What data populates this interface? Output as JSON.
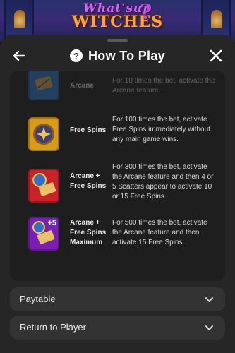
{
  "game": {
    "logo_line1": "What'sup",
    "logo_line2": "WITCHES",
    "logo_mark": "?"
  },
  "header": {
    "title": "How To Play",
    "back_icon": "arrow-left-icon",
    "help_icon": "question-circle-icon",
    "close_icon": "close-icon",
    "help_glyph": "?"
  },
  "bonus_buys": [
    {
      "name": "Arcane",
      "description": "For 10 times the bet, activate the Arcane feature.",
      "icon": "arcane-book-icon",
      "color": "#2f7fd8"
    },
    {
      "name": "Free Spins",
      "description": "For 100 times the bet, activate Free Spins immediately without any main game wins.",
      "icon": "free-spins-coin-icon",
      "color": "#d89a1a"
    },
    {
      "name": "Arcane + Free Spins",
      "description": "For 300 times the bet, activate the Arcane feature and then 4 or 5 Scatters appear to activate 10 or 15 Free Spins.",
      "icon": "arcane-free-spins-icon",
      "color": "#c8222a"
    },
    {
      "name": "Arcane + Free Spins Maximum",
      "description": "For 500 times the bet, activate the Arcane feature and then activate 15 Free Spins.",
      "icon": "arcane-free-spins-max-icon",
      "color": "#7a1fb0",
      "badge": "+5"
    }
  ],
  "sections": [
    {
      "label": "Paytable",
      "icon": "chevron-down-icon"
    },
    {
      "label": "Return to Player",
      "icon": "chevron-down-icon"
    }
  ]
}
